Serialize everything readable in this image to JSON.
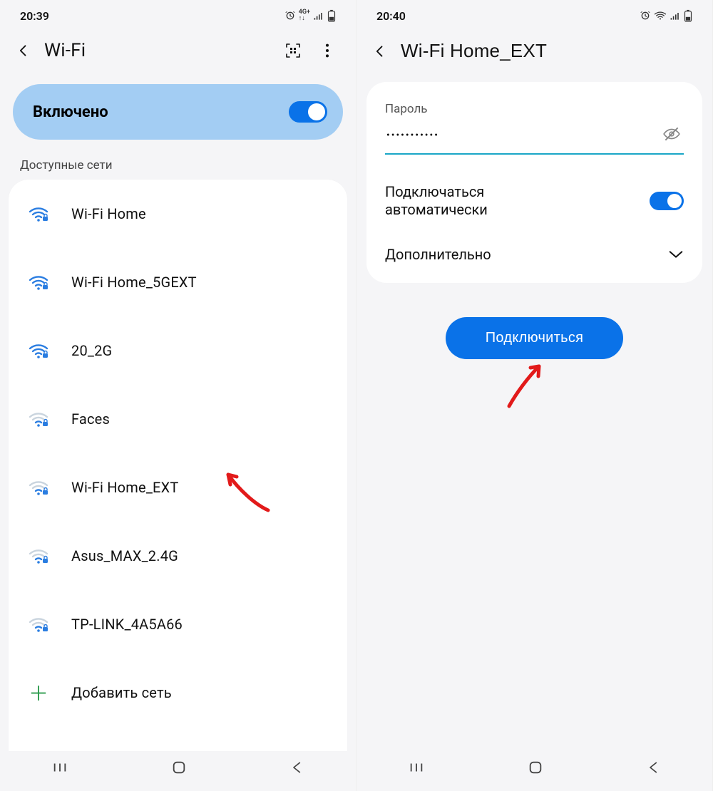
{
  "left": {
    "status_time": "20:39",
    "header_title": "Wi-Fi",
    "wifi_on_label": "Включено",
    "section_label": "Доступные сети",
    "networks": [
      {
        "ssid": "Wi-Fi Home",
        "strength": "strong",
        "secured": true
      },
      {
        "ssid": "Wi-Fi Home_5GEXT",
        "strength": "strong",
        "secured": true
      },
      {
        "ssid": "20_2G",
        "strength": "strong",
        "secured": true
      },
      {
        "ssid": "Faces",
        "strength": "weak",
        "secured": true
      },
      {
        "ssid": "Wi-Fi Home_EXT",
        "strength": "weak",
        "secured": true
      },
      {
        "ssid": "Asus_MAX_2.4G",
        "strength": "weak",
        "secured": true
      },
      {
        "ssid": "TP-LINK_4A5A66",
        "strength": "weak",
        "secured": true
      }
    ],
    "add_network_label": "Добавить сеть"
  },
  "right": {
    "status_time": "20:40",
    "header_title": "Wi-Fi Home_EXT",
    "password_label": "Пароль",
    "password_value": "•••••••••••",
    "auto_connect_label": "Подключаться автоматически",
    "auto_connect_line1": "Подключаться",
    "auto_connect_line2": "автоматически",
    "advanced_label": "Дополнительно",
    "connect_button": "Подключиться"
  },
  "icons": {
    "back": "chevron-left",
    "qr": "qr-scan",
    "more": "more-vert",
    "eye_off": "eye-off",
    "expand": "chevron-down"
  }
}
